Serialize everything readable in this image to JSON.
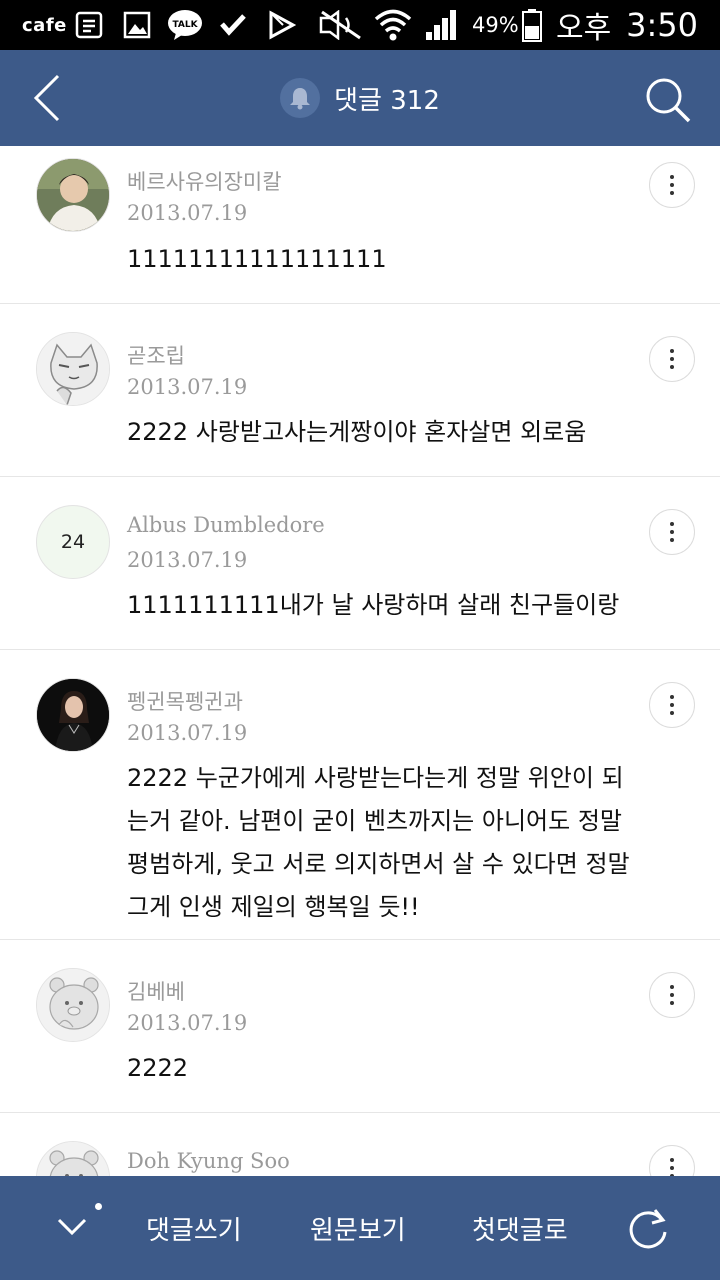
{
  "status_bar": {
    "app_label": "cafe",
    "icons": [
      "note-icon",
      "image-icon",
      "talk-icon",
      "check-icon",
      "play-store-icon",
      "mute-icon",
      "wifi-icon",
      "signal-icon",
      "battery-icon"
    ],
    "talk_label": "TALK",
    "battery": "49%",
    "ampm": "오후",
    "time": "3:50"
  },
  "header": {
    "title": "댓글 312",
    "icons": [
      "back-icon",
      "bell-icon",
      "search-icon"
    ]
  },
  "comments": [
    {
      "author": "베르사유의장미칼",
      "date": "2013.07.19",
      "text": "11111111111111111",
      "avatar": "photo"
    },
    {
      "author": "곧조립",
      "date": "2013.07.19",
      "text": "2222 사랑받고사는게짱이야 혼자살면 외로움",
      "avatar": "cat-drawing"
    },
    {
      "author": "Albus Dumbledore",
      "date": "2013.07.19",
      "text": "1111111111내가 날 사랑하며 살래 친구들이랑",
      "avatar_label": "24"
    },
    {
      "author": "펭귄목펭귄과",
      "date": "2013.07.19",
      "text": "2222 누군가에게 사랑받는다는게 정말 위안이 되는거 같아. 남편이 굳이 벤츠까지는 아니어도 정말 평범하게, 웃고 서로 의지하면서 살 수 있다면 정말 그게 인생 제일의 행복일 듯!!",
      "avatar": "photo"
    },
    {
      "author": "김베베",
      "date": "2013.07.19",
      "text": "2222",
      "avatar": "bear-drawing"
    },
    {
      "author": "Doh Kyung Soo",
      "date": "",
      "text": "",
      "avatar": "bear-drawing"
    }
  ],
  "bottom_bar": {
    "write_label": "댓글쓰기",
    "original_label": "원문보기",
    "first_label": "첫댓글로",
    "icons": [
      "chevron-down-icon",
      "refresh-icon"
    ]
  },
  "colors": {
    "header_bg": "#3d5a89",
    "status_bg": "#000000",
    "meta_text": "#9a9a9a"
  }
}
